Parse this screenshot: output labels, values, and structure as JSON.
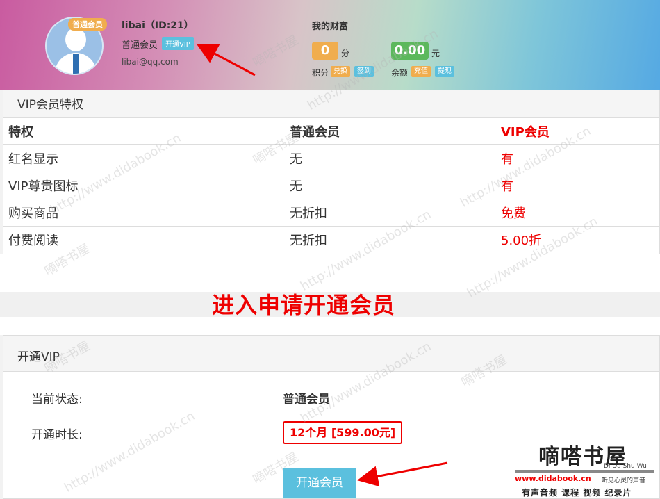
{
  "profile": {
    "level_badge": "普通会员",
    "name": "libai（ID:21）",
    "level": "普通会员",
    "open_vip_label": "开通VIP",
    "email": "libai@qq.com"
  },
  "wealth": {
    "title": "我的财富",
    "points_value": "0",
    "points_unit": "分",
    "points_label": "积分",
    "exchange_label": "兑换",
    "checkin_label": "签到",
    "balance_value": "0.00",
    "balance_unit": "元",
    "balance_label": "余额",
    "recharge_label": "充值",
    "withdraw_label": "提现"
  },
  "privileges": {
    "title": "VIP会员特权",
    "headers": [
      "特权",
      "普通会员",
      "VIP会员"
    ],
    "rows": [
      [
        "红名显示",
        "无",
        "有"
      ],
      [
        "VIP尊贵图标",
        "无",
        "有"
      ],
      [
        "购买商品",
        "无折扣",
        "免费"
      ],
      [
        "付费阅读",
        "无折扣",
        "5.00折"
      ]
    ]
  },
  "annotation": "进入申请开通会员",
  "open_vip": {
    "title": "开通VIP",
    "status_label": "当前状态:",
    "status_value": "普通会员",
    "duration_label": "开通时长:",
    "duration_value": "12个月 [599.00元]",
    "submit_label": "开通会员"
  },
  "watermark": {
    "logo_title": "嘀嗒书屋",
    "logo_pinyin": "Di Da Shu Wu",
    "url": "www.didabook.cn",
    "slogan": "听见心灵的声音",
    "tagline": "有声音频 课程 视频 纪录片",
    "background_text": [
      "嘀嗒书屋",
      "http://www.didabook.cn"
    ]
  },
  "colors": {
    "accent_red": "#ee0000",
    "info_blue": "#5bc0de",
    "warning_orange": "#f0ad4e",
    "success_green": "#5cb85c"
  }
}
